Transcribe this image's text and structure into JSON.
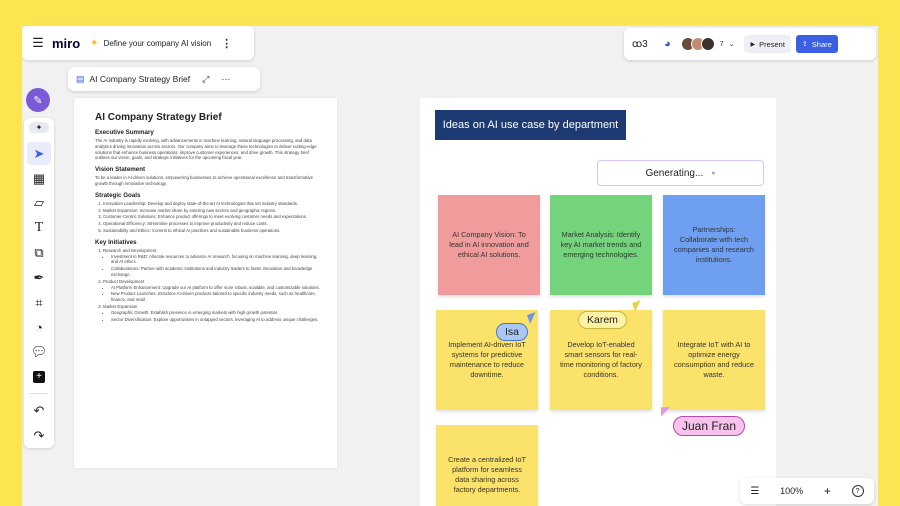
{
  "header": {
    "logo": "miro",
    "board_title": "Define your company AI vision",
    "collab_count": "7",
    "present_label": "Present",
    "share_label": "Share"
  },
  "doc_tab": {
    "title": "AI Company Strategy Brief"
  },
  "document": {
    "title": "AI Company Strategy Brief",
    "summary_heading": "Executive Summary",
    "summary_text": "The AI industry is rapidly evolving, with advancements in machine learning, natural language processing, and data analytics driving innovation across sectors. Our company aims to leverage these technologies to deliver cutting-edge solutions that enhance business operations, improve customer experiences, and drive growth. This strategy brief outlines our vision, goals, and strategic initiatives for the upcoming fiscal year.",
    "vision_heading": "Vision Statement",
    "vision_text": "To be a leader in AI-driven solutions, empowering businesses to achieve operational excellence and transformative growth through innovative technology.",
    "goals_heading": "Strategic Goals",
    "goals": [
      "Innovation Leadership: Develop and deploy state-of-the-art AI technologies that set industry standards.",
      "Market Expansion: Increase market share by entering new sectors and geographic regions.",
      "Customer-Centric Solutions: Enhance product offerings to meet evolving customer needs and expectations.",
      "Operational Efficiency: Streamline processes to improve productivity and reduce costs.",
      "Sustainability and Ethics: Commit to ethical AI practices and sustainable business operations."
    ],
    "initiatives_heading": "Key Initiatives",
    "initiatives": [
      {
        "label": "Research and Development",
        "items": [
          "Investment in R&D: Allocate resources to advance AI research, focusing on machine learning, deep learning, and AI ethics.",
          "Collaborations: Partner with academic institutions and industry leaders to foster innovation and knowledge exchange."
        ]
      },
      {
        "label": "Product Development",
        "items": [
          "AI Platform Enhancement: Upgrade our AI platform to offer more robust, scalable, and customizable solutions.",
          "New Product Launches: Introduce AI-driven products tailored to specific industry needs, such as healthcare, finance, and retail."
        ]
      },
      {
        "label": "Market Expansion",
        "items": [
          "Geographic Growth: Establish presence in emerging markets with high growth potential.",
          "Sector Diversification: Explore opportunities in untapped sectors, leveraging AI to address unique challenges."
        ]
      }
    ]
  },
  "frame": {
    "title": "Ideas on AI use case by department",
    "generating_label": "Generating..."
  },
  "notes": [
    {
      "text": "AI Company Vision: To lead in AI innovation and ethical AI solutions.",
      "color": "#f19c9c"
    },
    {
      "text": "Market Analysis: Identify key AI market trends and emerging technologies.",
      "color": "#73d47c"
    },
    {
      "text": "Partnerships: Collaborate with tech companies and research institutions.",
      "color": "#6f9ff0"
    },
    {
      "text": "Implement AI-driven IoT systems for predictive maintenance to reduce downtime.",
      "color": "#fbe36b"
    },
    {
      "text": "Develop IoT-enabled smart sensors for real-time monitoring of factory conditions.",
      "color": "#fbe36b"
    },
    {
      "text": "Integrate IoT with AI to optimize energy consumption and reduce waste.",
      "color": "#fbe36b"
    },
    {
      "text": "Create a centralized IoT platform for seamless data sharing across factory departments.",
      "color": "#fbe36b"
    }
  ],
  "cursors": [
    {
      "name": "Isa",
      "bg": "#a9c8f5",
      "border": "#4a78c8",
      "pointer": "#6d94e0"
    },
    {
      "name": "Karem",
      "bg": "#fdf3a4",
      "border": "#c7b53c",
      "pointer": "#e4d350"
    },
    {
      "name": "Juan Fran",
      "bg": "#f7c2ec",
      "border": "#b74aa7",
      "pointer": "#e39ad8"
    }
  ],
  "bottom_bar": {
    "zoom": "100%"
  }
}
